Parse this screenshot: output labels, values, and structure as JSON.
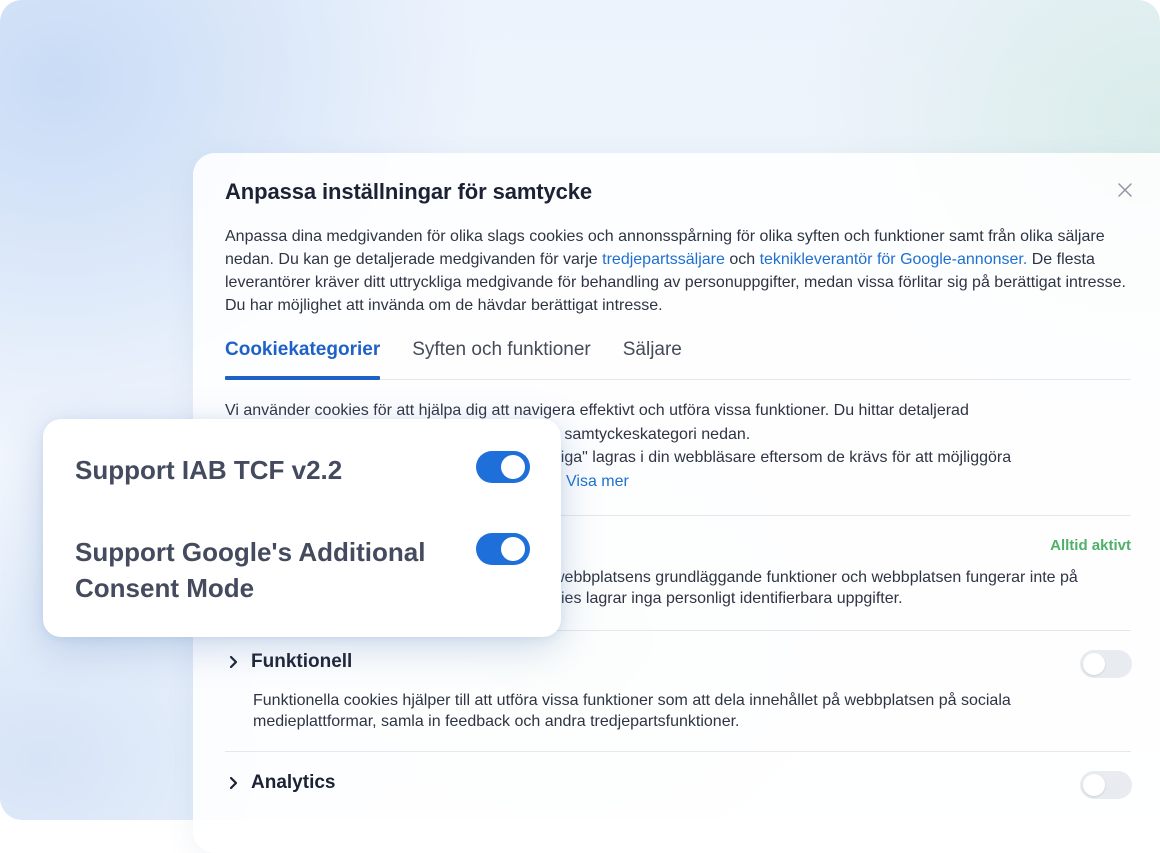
{
  "dialog": {
    "title": "Anpassa inställningar för samtycke",
    "close_icon": "close-icon",
    "description": {
      "part1": "Anpassa dina medgivanden för olika slags cookies och annonsspårning för olika syften och funktioner samt från olika säljare nedan. Du kan ge detaljerade medgivanden för varje ",
      "link1": "tredjepartssäljare",
      "part2": " och ",
      "link2": "teknikleverantör för Google-annonser.",
      "part3": " De flesta leverantörer kräver ditt uttryckliga medgivande för behandling av personuppgifter, medan vissa förlitar sig på berättigat intresse. Du har möjlighet att invända om de hävdar berättigat intresse."
    },
    "tabs": [
      "Cookiekategorier",
      "Syften och funktioner",
      "Säljare"
    ],
    "active_tab": "Cookiekategorier",
    "intro": {
      "line1": "Vi använder cookies för att hjälpa dig att navigera effektivt och utföra vissa funktioner. Du hittar detaljerad",
      "line2": "ve samtyckeskategori nedan.",
      "line3": "ndiga\" lagras i din webbläsare eftersom de krävs för att möjliggöra",
      "show_more": "Visa mer"
    },
    "necessary": {
      "badge": "Alltid aktivt",
      "line1": "webbplatsens grundläggande funktioner och webbplatsen fungerar inte på",
      "line2": "kies lagrar inga personligt identifierbara uppgifter."
    },
    "categories": [
      {
        "title": "Funktionell",
        "description": "Funktionella cookies hjälper till att utföra vissa funktioner som att dela innehållet på webbplatsen på sociala medieplattformar, samla in feedback och andra tredjepartsfunktioner.",
        "enabled": false
      },
      {
        "title": "Analytics",
        "enabled": false
      }
    ]
  },
  "feature_card": {
    "items": [
      {
        "label": "Support IAB TCF v2.2",
        "enabled": true
      },
      {
        "label": "Support Google's Additional Consent Mode",
        "enabled": true
      }
    ]
  },
  "colors": {
    "accent": "#1f62c7",
    "link": "#1f6fd1",
    "toggle_on": "#1e6fd9",
    "always_active": "#4fb06a"
  }
}
